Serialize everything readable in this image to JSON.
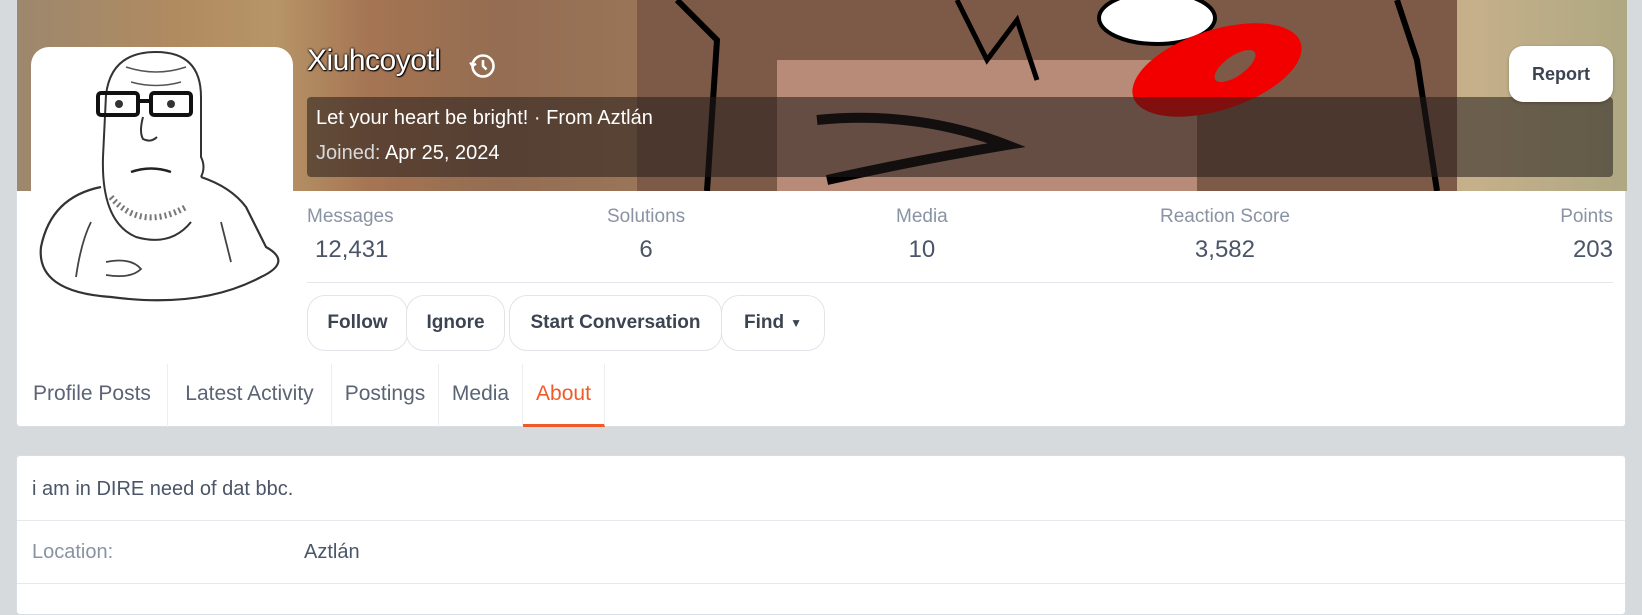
{
  "profile": {
    "username": "Xiuhcoyotl",
    "tagline": "Let your heart be bright! · From Aztlán",
    "joined_label": "Joined:",
    "joined_date": "Apr 25, 2024",
    "report_label": "Report"
  },
  "stats": [
    {
      "label": "Messages",
      "value": "12,431"
    },
    {
      "label": "Solutions",
      "value": "6"
    },
    {
      "label": "Media",
      "value": "10"
    },
    {
      "label": "Reaction Score",
      "value": "3,582"
    },
    {
      "label": "Points",
      "value": "203"
    }
  ],
  "actions": {
    "follow": "Follow",
    "ignore": "Ignore",
    "start_conversation": "Start Conversation",
    "find": "Find"
  },
  "tabs": [
    {
      "label": "Profile Posts"
    },
    {
      "label": "Latest Activity"
    },
    {
      "label": "Postings"
    },
    {
      "label": "Media"
    },
    {
      "label": "About",
      "active": true
    }
  ],
  "about": {
    "bio": "i am in DIRE need of dat bbc.",
    "location_label": "Location:",
    "location_value": "Aztlán"
  },
  "colors": {
    "accent": "#f05a28",
    "background": "#d6dadd",
    "muted_text": "#8993a4"
  }
}
